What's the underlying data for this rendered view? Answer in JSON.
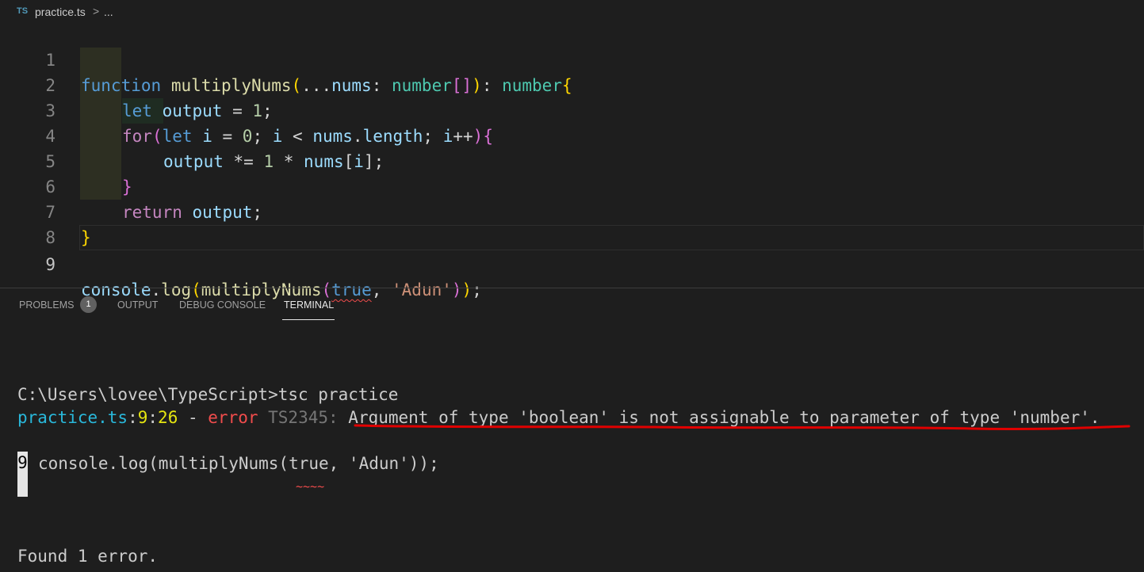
{
  "breadcrumb": {
    "lang_icon": "TS",
    "file": "practice.ts",
    "separator": ">",
    "more": "..."
  },
  "editor": {
    "line_numbers": [
      "1",
      "2",
      "3",
      "4",
      "5",
      "6",
      "7",
      "8",
      "9"
    ],
    "line1": {
      "kw": "function",
      "fn": "multiplyNums",
      "paren": "(",
      "spread": "...",
      "param": "nums",
      "colon": ": ",
      "type": "number",
      "brackets": "[]",
      "rparen": ")",
      "colon2": ": ",
      "ret": "number",
      "brace": "{"
    },
    "line2": {
      "kw": "let",
      "var": "output",
      "eq": " = ",
      "num": "1",
      "semi": ";"
    },
    "line3": {
      "kw": "for",
      "paren": "(",
      "let": "let",
      "i1": "i",
      "eq": " = ",
      "zero": "0",
      "semi1": "; ",
      "i2": "i",
      "lt": " < ",
      "nums": "nums",
      "dot": ".",
      "length": "length",
      "semi2": "; ",
      "i3": "i",
      "inc": "++",
      "rparen": ")",
      "brace": "{"
    },
    "line4": {
      "var": "output",
      "op": " *= ",
      "one": "1",
      "star": " * ",
      "nums": "nums",
      "lb": "[",
      "i": "i",
      "rb": "]",
      "semi": ";"
    },
    "line5": {
      "brace": "}"
    },
    "line6": {
      "kw": "return",
      "var": "output",
      "semi": ";"
    },
    "line7": {
      "brace": "}"
    },
    "line9": {
      "console": "console",
      "dot": ".",
      "log": "log",
      "p1": "(",
      "fn": "multiplyNums",
      "p2": "(",
      "arg1": "true",
      "comma": ", ",
      "arg2": "'Adun'",
      "p2c": ")",
      "p1c": ")",
      "semi": ";"
    }
  },
  "panel": {
    "tabs": [
      {
        "label": "PROBLEMS",
        "badge": "1"
      },
      {
        "label": "OUTPUT"
      },
      {
        "label": "DEBUG CONSOLE"
      },
      {
        "label": "TERMINAL",
        "active": true
      }
    ]
  },
  "terminal": {
    "prompt": "C:\\Users\\lovee\\TypeScript>tsc practice",
    "err_file": "practice.ts",
    "err_colon1": ":",
    "err_line": "9",
    "err_colon2": ":",
    "err_col": "26",
    "err_dash": " - ",
    "err_word": "error",
    "err_code": " TS2345: ",
    "err_msg": "Argument of type 'boolean' is not assignable to parameter of type 'number'.",
    "code_line_no": "9",
    "code_line": "console.log(multiplyNums(true, 'Adun'));",
    "squiggle": "~~~~",
    "found": "Found 1 error."
  },
  "colors": {
    "background": "#1e1e1e",
    "error": "#f14c4c",
    "annotation": "#e00000",
    "terminal_file": "#29b8db",
    "terminal_number": "#e5e510"
  }
}
